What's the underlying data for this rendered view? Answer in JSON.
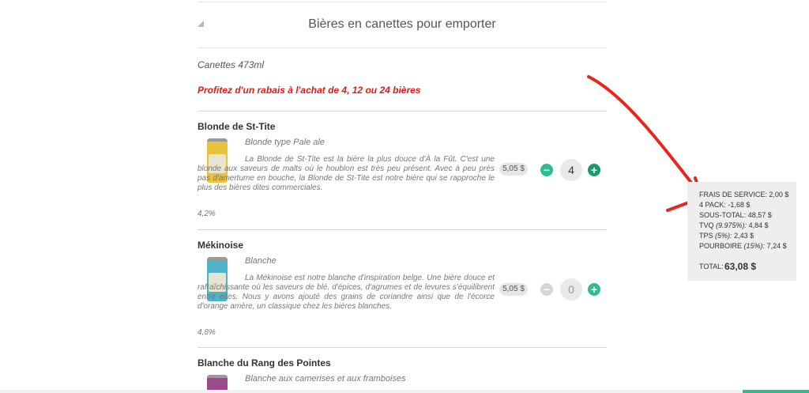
{
  "section": {
    "title": "Bières en canettes pour emporter",
    "subtitle": "Canettes 473ml",
    "promo": "Profitez d'un rabais à l'achat de 4, 12 ou 24 bières"
  },
  "products": [
    {
      "name": "Blonde de St-Tite",
      "type": "Blonde type Pale ale",
      "description": "La Blonde de St-Tite est la bière la plus douce d'À la Fût. C'est une blonde aux saveurs de malts où le houblon est très peu présent. Avec à peu près pas d'amertume en bouche, la Blonde de St-Tite est notre bière qui se rapproche le plus des bières dites commerciales.",
      "abv": "4,2%",
      "price": "5,05 $",
      "quantity": "4",
      "can_color": "#e8c23a"
    },
    {
      "name": "Mékinoise",
      "type": "Blanche",
      "description": "La Mékinoise est notre blanche d'inspiration belge. Une bière douce et rafraîchissante où les saveurs de blé, d'épices, d'agrumes et de levures s'équilibrent entre elles. Nous y avons ajouté des grains de coriandre ainsi que de l'écorce d'orange amère, un classique chez les bières blanches.",
      "abv": "4,8%",
      "price": "5,05 $",
      "quantity": "0",
      "can_color": "#4fb3c7"
    },
    {
      "name": "Blanche du Rang des Pointes",
      "type": "Blanche aux camerises et aux framboises",
      "can_color": "#9b4a8c"
    }
  ],
  "summary": {
    "service_label": "FRAIS DE SERVICE:",
    "service_value": "2,00 $",
    "pack_label": "4 PACK:",
    "pack_value": "-1,68 $",
    "subtotal_label": "SOUS-TOTAL:",
    "subtotal_value": "48,57 $",
    "tvq_label": "TVQ",
    "tvq_rate": "(9.975%):",
    "tvq_value": "4,84 $",
    "tps_label": "TPS",
    "tps_rate": "(5%):",
    "tps_value": "2,43 $",
    "tip_label": "POURBOIRE",
    "tip_rate": "(15%):",
    "tip_value": "7,24 $",
    "total_label": "TOTAL:",
    "total_value": "63,08 $"
  },
  "colors": {
    "accent_green": "#2ebd8e",
    "promo_red": "#e21b1b",
    "annotation_red": "#e8261e"
  },
  "icons": [
    "collapse-triangle-icon",
    "minus-icon",
    "plus-icon",
    "annotation-arrow"
  ]
}
